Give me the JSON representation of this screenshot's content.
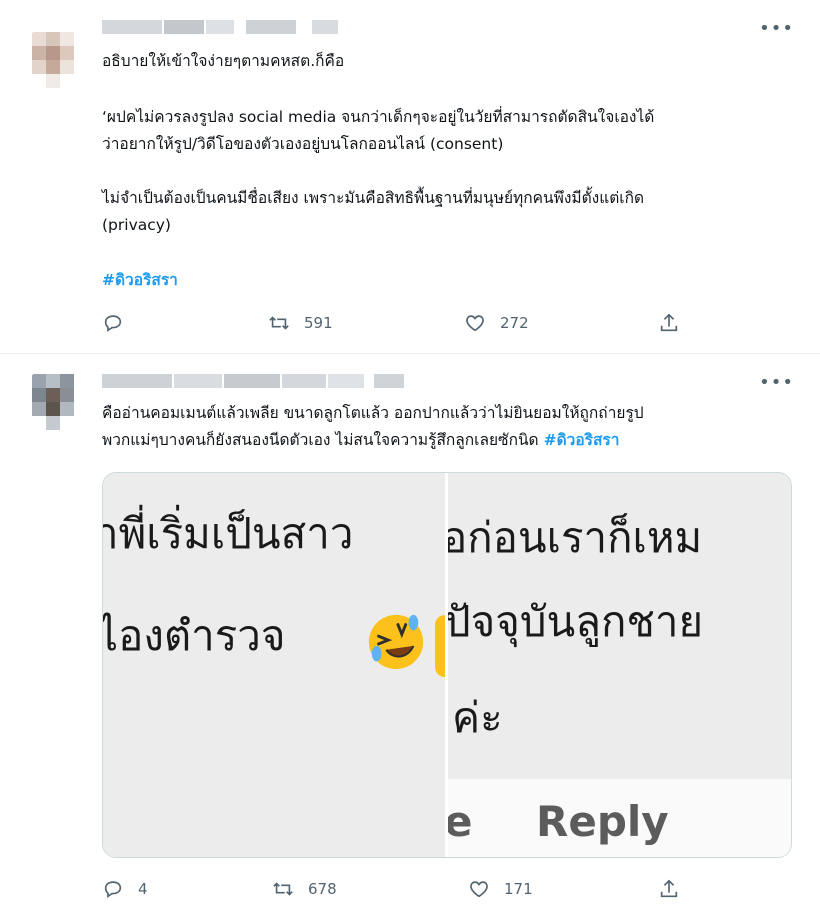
{
  "tweet1": {
    "text_line1": "อธิบายให้เข้าใจง่ายๆตามคหสต.ก็คือ",
    "text_line2": "‘ผปคไม่ควรลงรูปลง social media จนกว่าเด็กๆจะอยู่ในวัยที่สามารถตัดสินใจเองได้",
    "text_line3": "ว่าอยากให้รูป/วิดีโอของตัวเองอยู่บนโลกออนไลน์ (consent)",
    "text_line4": "ไม่จำเป็นต้องเป็นคนมีชื่อเสียง เพราะมันคือสิทธิพื้นฐานที่มนุษย์ทุกคนพึงมีตั้งแต่เกิด",
    "text_line5": "(privacy)",
    "hashtag": "#ดิวอริสรา",
    "more": "•••",
    "retweets": "591",
    "likes": "272"
  },
  "tweet2": {
    "text_line1": "คืออ่านคอมเมนต์แล้วเพลีย ขนาดลูกโตแล้ว ออกปากแล้วว่าไม่ยินยอมให้ถูกถ่ายรูป",
    "text_line2": "พวกแม่ๆบางคนก็ยังสนองนีดตัวเอง ไม่สนใจความรู้สึกลูกเลยซักนิด",
    "hashtag": "#ดิวอริสรา",
    "more": "•••",
    "replies": "4",
    "retweets": "678",
    "likes": "171",
    "media": {
      "left_line1": "าพี่เริ่มเป็นสาว",
      "left_line2": "ไองตำรวจ",
      "right_line1": "อก่อนเราก็เหม",
      "right_line2": "ปัจจุบันลูกชาย",
      "right_line3": "ค่ะ",
      "reply_left": "e",
      "reply_right": "Reply"
    }
  },
  "icons": {
    "reply": "reply-icon",
    "retweet": "retweet-icon",
    "like": "heart-icon",
    "share": "share-icon",
    "emoji": "rolling-laughing-emoji"
  },
  "colors": {
    "accent": "#1d9bf0",
    "text": "#0f1419",
    "muted": "#536471",
    "border": "#e6ecf0"
  }
}
